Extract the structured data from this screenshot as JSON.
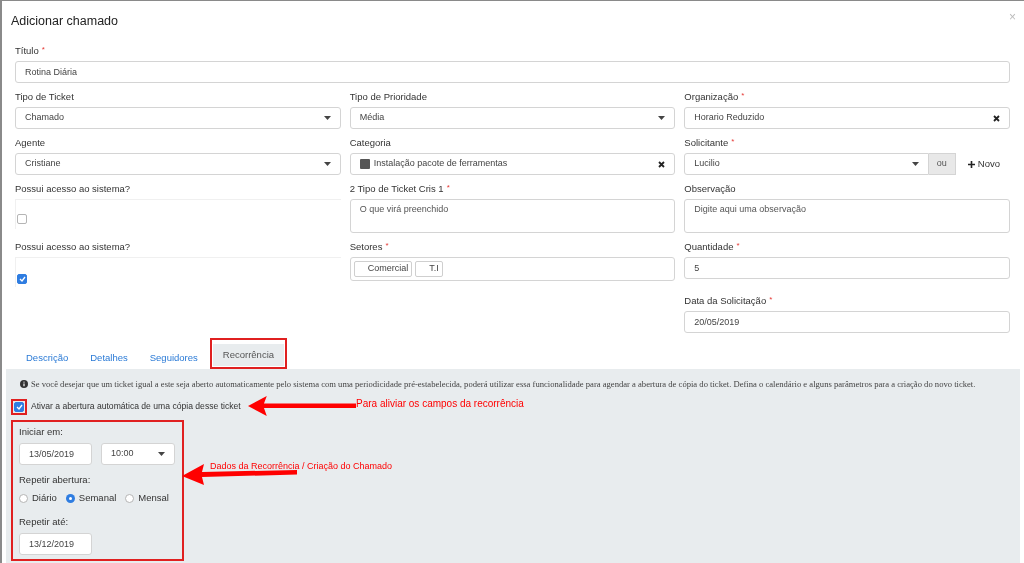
{
  "dialog": {
    "title": "Adicionar chamado",
    "close": "×"
  },
  "title_field": {
    "label": "Título",
    "required_mark": "*",
    "value": "Rotina Diária"
  },
  "rows": [
    {
      "cells": [
        {
          "kind": "select",
          "label": "Tipo de Ticket",
          "value": "Chamado"
        },
        {
          "kind": "select",
          "label": "Tipo de Prioridade",
          "value": "Média"
        },
        {
          "kind": "clearable",
          "label": "Organização",
          "required_mark": "*",
          "value": "Horario Reduzido"
        }
      ]
    },
    {
      "cells": [
        {
          "kind": "select",
          "label": "Agente",
          "value": "Cristiane"
        },
        {
          "kind": "clearable",
          "label": "Categoria",
          "value": "Instalação pacote de ferramentas",
          "color": "#555555"
        },
        {
          "kind": "select_addon",
          "label": "Solicitante",
          "required_mark": "*",
          "value": "Lucilio",
          "addon": "ou",
          "button": "Novo"
        }
      ]
    },
    {
      "cells": [
        {
          "kind": "checkbox",
          "label": "Possui acesso ao sistema?",
          "checked": false
        },
        {
          "kind": "textarea",
          "label": "2 Tipo de Ticket Cris 1",
          "required_mark": "*",
          "placeholder": "O que virá preenchido"
        },
        {
          "kind": "textarea",
          "label": "Observação",
          "placeholder": "Digite aqui uma observação"
        }
      ]
    },
    {
      "cells": [
        {
          "kind": "checkbox",
          "label": "Possui acesso ao sistema?",
          "checked": true
        },
        {
          "kind": "tags",
          "label": "Setores",
          "required_mark": "*",
          "tags": [
            "Comercial",
            "T.I"
          ]
        },
        {
          "kind": "input",
          "label": "Quantidade",
          "required_mark": "*",
          "value": "5"
        }
      ]
    },
    {
      "cells": [
        {
          "kind": "input",
          "label": "Data da Solicitação",
          "required_mark": "*",
          "value": "20/05/2019"
        }
      ]
    }
  ],
  "tabs": [
    {
      "label": "Descrição",
      "selected": false
    },
    {
      "label": "Detalhes",
      "selected": false
    },
    {
      "label": "Seguidores",
      "selected": false
    },
    {
      "label": "Recorrência",
      "selected": true
    }
  ],
  "recurrence": {
    "info": "Se você desejar que um ticket igual a este seja aberto automaticamente pelo sistema com uma periodicidade pré-estabelecida, poderá utilizar essa funcionalidade para agendar a abertura de cópia do ticket. Defina o calendário e alguns parâmetros para a criação do novo ticket.",
    "enable": {
      "label": "Ativar a abertura automática de uma cópia desse ticket",
      "checked": true
    },
    "start_label": "Iniciar em:",
    "start_date": "13/05/2019",
    "start_time": "10:00",
    "repeat_label": "Repetir abertura:",
    "options": [
      {
        "label": "Diário",
        "selected": false
      },
      {
        "label": "Semanal",
        "selected": true
      },
      {
        "label": "Mensal",
        "selected": false
      }
    ],
    "until_label": "Repetir até:",
    "until_date": "13/12/2019"
  },
  "annotations": [
    "Para aliviar os campos da recorrência",
    "Dados da Recorrência / Criação do Chamado"
  ]
}
